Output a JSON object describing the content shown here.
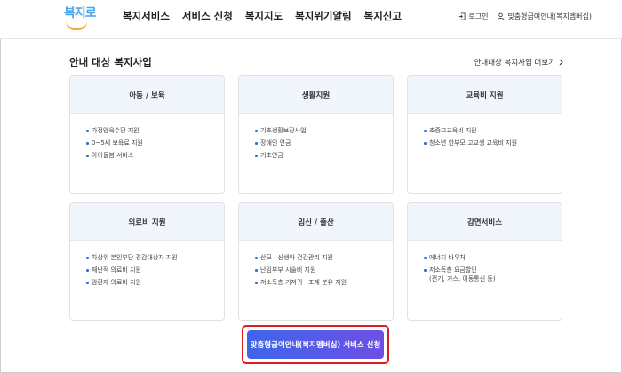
{
  "header": {
    "logo_text": "복지로",
    "nav": [
      "복지서비스",
      "서비스 신청",
      "복지지도",
      "복지위기알림",
      "복지신고"
    ],
    "login_label": "로그인",
    "membership_label": "맞춤형급여안내(복지멤버십)"
  },
  "section": {
    "title": "안내 대상 복지사업",
    "more_label": "안내대상 복지사업 더보기"
  },
  "cards": [
    {
      "title": "아동 / 보육",
      "items": [
        "가정양육수당 지원",
        "0~5세 보육료 지원",
        "아이돌봄 서비스"
      ]
    },
    {
      "title": "생활지원",
      "items": [
        "기초생활보장사업",
        "장애인 연금",
        "기초연금"
      ]
    },
    {
      "title": "교육비 지원",
      "items": [
        "초중고교육비 지원",
        "청소년 한부모 고교생 교육비 지원"
      ]
    },
    {
      "title": "의료비 지원",
      "items": [
        "차상위 본인부담 경감대상자 지원",
        "재난적 의료비 지원",
        "암환자 의료비 지원"
      ]
    },
    {
      "title": "임신 / 출산",
      "items": [
        "산모 · 신생아 건강관리 지원",
        "난임부부 시술비 지원",
        "저소득층 기저귀 · 조제 분유 지원"
      ]
    },
    {
      "title": "감면서비스",
      "items": [
        "에너지 바우처",
        "저소득층 요금할인",
        "(전기, 가스, 이동통신 등)"
      ]
    }
  ],
  "cta": {
    "label": "맞춤형급여안내(복지멤버십) 서비스 신청"
  },
  "colors": {
    "accent": "#3d66e8",
    "highlight_border": "#e01d1d",
    "card_header": "#f1f5fc"
  }
}
